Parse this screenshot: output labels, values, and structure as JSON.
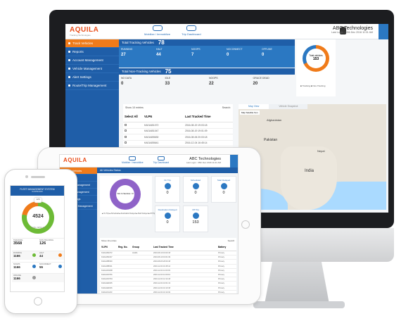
{
  "desktop": {
    "brand": "AQUILA",
    "brand_tagline": "Tracking Technologies",
    "nav": [
      "Mobilize / Immobilize",
      "Trip Dashboard"
    ],
    "user": {
      "name": "ABC Technologies",
      "last_login": "Last Login : 05th Dec 2016 11:01 AM"
    },
    "sidebar": [
      "Track Vehicles",
      "Reports",
      "Account Management",
      "Vehicle Management",
      "Alert Settings",
      "Route/Trip Management"
    ],
    "tracking": {
      "title": "Total Tracking Vehicles",
      "total": "78",
      "cells": [
        {
          "label": "RUNNING",
          "value": "27",
          "color": "#2b78c2"
        },
        {
          "label": "HALT",
          "value": "44",
          "color": "#2b78c2"
        },
        {
          "label": "NOGPS",
          "value": "7",
          "color": "#2b78c2"
        },
        {
          "label": "NOCONNECT",
          "value": "0",
          "color": "#2b78c2"
        },
        {
          "label": "OFFLINE",
          "value": "0",
          "color": "#2b78c2"
        }
      ]
    },
    "nontracking": {
      "title": "Total Non-Tracking Vehicles",
      "total": "75",
      "cells": [
        {
          "label": "NO DATA",
          "value": "0"
        },
        {
          "label": "IDLE",
          "value": "33"
        },
        {
          "label": "NOGPS",
          "value": "22"
        },
        {
          "label": "GRACE DEAD",
          "value": "20"
        }
      ]
    },
    "donut": {
      "label": "Total vehicles",
      "value": "153",
      "legend": "■ Tracking  ■ Non-Tracking"
    },
    "table": {
      "show_label": "Show",
      "entries_label": "entries",
      "page_size": "10",
      "search_label": "Search:",
      "headers": [
        "Select All",
        "VLPN",
        "Last Tracked Time"
      ],
      "rows": [
        [
          "KA01AB1072",
          "2016-08-19 19:03:18"
        ],
        [
          "KA01AB1047",
          "2016-08-19 19:01:09"
        ],
        [
          "KA01AB5630",
          "2016-08-06 20:03:18"
        ],
        [
          "KA01AB5641",
          "2016-12-04 16:45:14"
        ],
        [
          "KA01AD0298",
          "2016-12-04 11:03:03"
        ],
        [
          "KA01AD0791",
          "2016-12-03 11:09:19"
        ],
        [
          "KA01AD0794",
          "2016-12-04 12:14:18"
        ],
        [
          "KA01AE0045",
          "2016-12-04 10:01:13"
        ],
        [
          "KA01AE0046",
          "2016-12-04 10:13:18"
        ],
        [
          "KA01AF1243",
          "2016-12-04 10:14:02"
        ]
      ]
    },
    "map": {
      "tabs": [
        "Map View",
        "Vehicle Snapshot"
      ],
      "map_types": "Map  Satellite  Sun",
      "labels": [
        "Afghanistan",
        "Pakistan",
        "Nepal",
        "India"
      ]
    }
  },
  "tablet": {
    "brand": "AQUILA",
    "nav": [
      "Mobilize / Immobilize",
      "Trip Dashboard"
    ],
    "user": {
      "name": "ABC Technologies",
      "last_login": "Last Login : 05th Dec 2016 11:01 AM"
    },
    "sidebar": [
      "Track Vehicles",
      "Reports",
      "Account Management",
      "Vehicle Management",
      "Alert Settings",
      "Route/Trip Management"
    ],
    "status_title": "All Vehicles Status",
    "donut_center": "Not In Service / 0",
    "donut_label": "On Trip",
    "legend": "■ On Trip  ■ Scheduled  ■ Destination Delayed  ■ Start Delayed  ■ Off Trip",
    "tiles": [
      {
        "label": "On Trip",
        "value": "0"
      },
      {
        "label": "Scheduled",
        "value": "0"
      },
      {
        "label": "Start Delayed",
        "value": "0"
      },
      {
        "label": "Destination Delayed",
        "value": "0"
      },
      {
        "label": "Off Trip",
        "value": "153"
      }
    ],
    "table": {
      "show_label": "Show",
      "entries_label": "entries",
      "page_size": "10",
      "search_label": "Search:",
      "headers": [
        "VLPN",
        "Reg. No.",
        "Group",
        "Last Tracked Time",
        "Battery"
      ],
      "rows": [
        [
          "KA01AB1072",
          "",
          "AGRA",
          "2016-08-19 19:03:18",
          "Primary"
        ],
        [
          "KA01AB1047",
          "",
          "",
          "2016-08-19 19:01:09",
          "Primary"
        ],
        [
          "KA01AB5630",
          "",
          "",
          "2016-08-06 20:03:18",
          "Primary"
        ],
        [
          "KA01AB5641",
          "",
          "",
          "2016-12-04 16:45:14",
          "Primary"
        ],
        [
          "KA01AD0298",
          "",
          "",
          "2016-12-04 11:03:03",
          "Primary"
        ],
        [
          "KA01AD0791",
          "",
          "",
          "2016-12-03 11:09:19",
          "Primary"
        ],
        [
          "KA01AD0794",
          "",
          "",
          "2016-12-04 12:14:18",
          "Primary"
        ],
        [
          "KA01AE0045",
          "",
          "",
          "2016-12-04 10:01:13",
          "Primary"
        ],
        [
          "KA01AE0046",
          "",
          "",
          "2016-12-04 10:13:18",
          "Primary"
        ],
        [
          "KA01AF1243",
          "",
          "",
          "2016-12-04 10:14:02",
          "Primary"
        ]
      ]
    }
  },
  "phone": {
    "title": "FLEET MANAGEMENT SYSTEM",
    "subtitle": "DASHBOARD",
    "total_badge": "126",
    "center_value": "4524",
    "center_label": "TOTAL VEHICLES",
    "tracking": {
      "label": "TRACKING",
      "value": "3568"
    },
    "nontracking": {
      "label": "NON-TRACKING",
      "value": "126"
    },
    "rows": [
      {
        "left_label": "RUNNING",
        "left_value": "1166",
        "right_label": "HALT",
        "right_value": "44"
      },
      {
        "left_label": "NOGPS",
        "left_value": "1166",
        "right_label": "NOCONNECT",
        "right_value": "55"
      },
      {
        "left_label": "OFFLINE",
        "left_value": "1166",
        "right_label": "",
        "right_value": ""
      }
    ],
    "colors": {
      "accent": "#f07b1a",
      "primary": "#1f5ea8",
      "green": "#6dbb36"
    }
  }
}
